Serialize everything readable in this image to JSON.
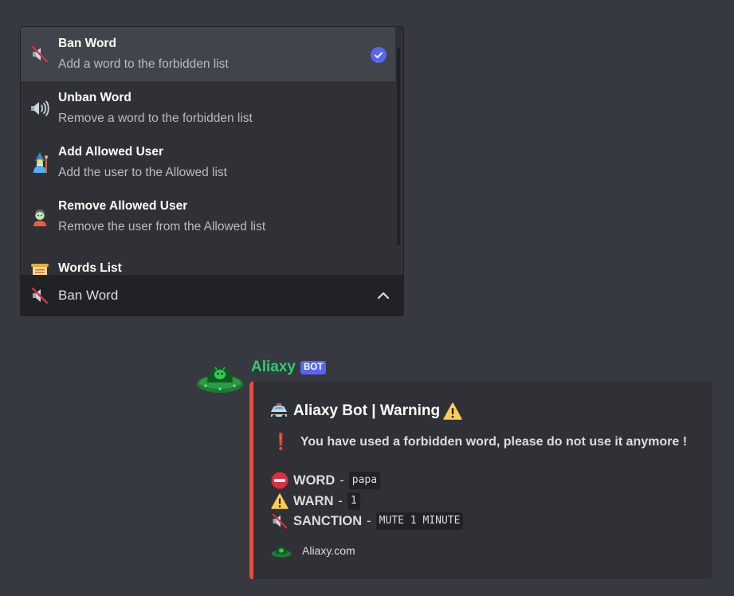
{
  "select_menu": {
    "options": [
      {
        "title": "Ban Word",
        "description": "Add a word to the forbidden list",
        "icon": "muted-speaker-icon",
        "selected": true
      },
      {
        "title": "Unban Word",
        "description": "Remove a word to the forbidden list",
        "icon": "speaker-icon",
        "selected": false
      },
      {
        "title": "Add Allowed User",
        "description": "Add the user to the Allowed list",
        "icon": "wizard-icon",
        "selected": false
      },
      {
        "title": "Remove Allowed User",
        "description": "Remove the user from the Allowed list",
        "icon": "zombie-icon",
        "selected": false
      },
      {
        "title": "Words List",
        "description": "",
        "icon": "scroll-icon",
        "selected": false
      }
    ],
    "selected_label": "Ban Word",
    "selected_icon": "muted-speaker-icon",
    "expanded": true
  },
  "message": {
    "author": "Aliaxy",
    "bot_tag": "BOT",
    "author_color": "#2ecc71",
    "avatar_icon": "green-alien-avatar",
    "embed": {
      "color": "#e74c3c",
      "title": "Aliaxy Bot | Warning",
      "title_icon_left": "police-car-icon",
      "title_icon_right": "warning-icon",
      "description": "You have used a forbidden word, please do not use it anymore !",
      "description_icon": "exclamation-icon",
      "fields": [
        {
          "icon": "no-entry-icon",
          "name": "WORD",
          "separator": "-",
          "value": "papa"
        },
        {
          "icon": "warning-icon",
          "name": "WARN",
          "separator": "-",
          "value": "1"
        },
        {
          "icon": "muted-speaker-icon",
          "name": "SANCTION",
          "separator": "-",
          "value": "MUTE 1 MINUTE"
        }
      ],
      "footer": {
        "text": "Aliaxy.com",
        "icon": "green-alien-footer-icon"
      }
    }
  },
  "colors": {
    "background": "#36393f",
    "menu_background": "#2f3136",
    "selected_option": "#40444b",
    "blurple": "#5865f2"
  }
}
